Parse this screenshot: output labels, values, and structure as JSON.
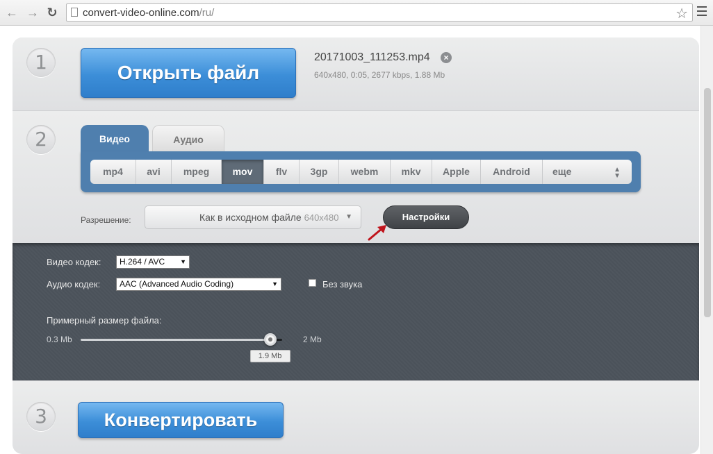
{
  "browser": {
    "url_host": "convert-video-online.com",
    "url_path": "/ru/"
  },
  "step1": {
    "number": "1",
    "open_button": "Открыть файл",
    "file_name": "20171003_111253.mp4",
    "file_meta": "640x480, 0:05, 2677 kbps, 1.88 Mb"
  },
  "step2": {
    "number": "2",
    "tabs": [
      {
        "label": "Видео",
        "active": true
      },
      {
        "label": "Аудио",
        "active": false
      }
    ],
    "formats": [
      "mp4",
      "avi",
      "mpeg",
      "mov",
      "flv",
      "3gp",
      "webm",
      "mkv",
      "Apple",
      "Android",
      "еще"
    ],
    "selected_format": "mov",
    "resolution_label": "Разрешение:",
    "resolution_value": "Как в исходном файле",
    "resolution_dims": "640x480",
    "settings_button": "Настройки"
  },
  "settings": {
    "video_codec_label": "Видео кодек:",
    "video_codec_value": "H.264 / AVC",
    "audio_codec_label": "Аудио кодек:",
    "audio_codec_value": "AAC (Advanced Audio Coding)",
    "mute_label": "Без звука",
    "mute_checked": false,
    "size_label": "Примерный размер файла:",
    "size_min": "0.3 Mb",
    "size_max": "2 Mb",
    "size_value": "1.9 Mb",
    "size_fraction": 0.94
  },
  "step3": {
    "number": "3",
    "convert_button": "Конвертировать"
  },
  "colors": {
    "accent_blue": "#3c8ed8",
    "tab_blue": "#4f7fae",
    "selected_format": "#5f6b77",
    "panel_dark": "#4b525a",
    "arrow_red": "#c0141c"
  }
}
